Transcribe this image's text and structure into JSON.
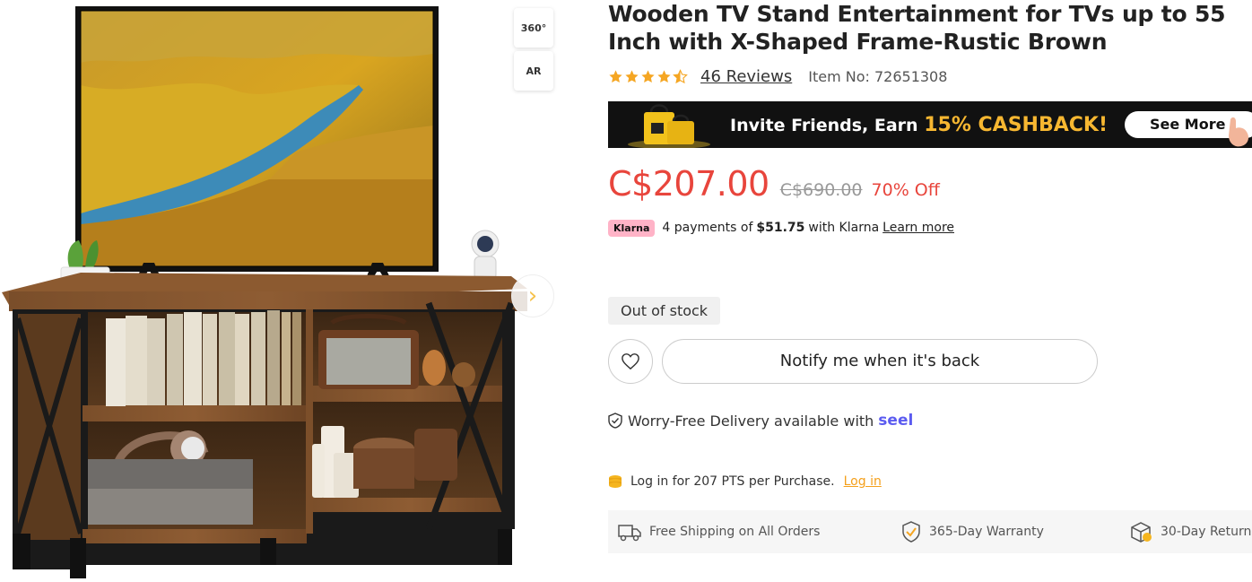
{
  "gallery": {
    "view_360_label": "360°",
    "view_ar_label": "AR",
    "next_icon": "chevron-right-icon"
  },
  "product": {
    "title": "Wooden TV Stand Entertainment for TVs up to 55 Inch with X-Shaped Frame-Rustic Brown",
    "rating": 4.5,
    "reviews_label": "46 Reviews",
    "item_no": "Item No: 72651308"
  },
  "banner": {
    "text_main": "Invite Friends, Earn ",
    "text_accent": "15% CASHBACK!",
    "button": "See More"
  },
  "pricing": {
    "price": "C$207.00",
    "old_price": "C$690.00",
    "discount": "70% Off"
  },
  "klarna": {
    "badge": "Klarna",
    "pre": "4 payments of",
    "amount": "$51.75",
    "post": "with Klarna",
    "learn_more": "Learn more"
  },
  "stock": {
    "status": "Out of stock",
    "notify_button": "Notify me when it's back"
  },
  "delivery": {
    "text": "Worry-Free Delivery available with",
    "brand": "seel"
  },
  "points": {
    "text": "Log in for 207 PTS per Purchase.",
    "login": "Log in"
  },
  "perks": [
    {
      "label": "Free Shipping on All Orders",
      "icon": "truck-icon"
    },
    {
      "label": "365-Day Warranty",
      "icon": "shield-check-icon"
    },
    {
      "label": "30-Day Return",
      "icon": "return-box-icon"
    }
  ],
  "colors": {
    "price_red": "#e8453c",
    "accent_yellow": "#f7b731",
    "link_orange": "#f4a01c",
    "seel_purple": "#5b5bf0",
    "klarna_pink": "#ffb3c7"
  }
}
